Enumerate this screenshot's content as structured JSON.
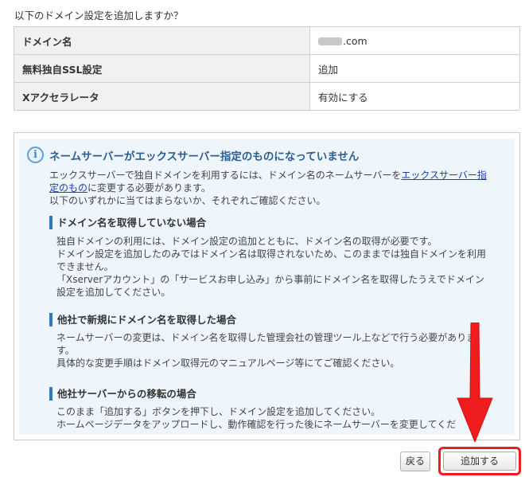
{
  "question": "以下のドメイン設定を追加しますか？",
  "confirm_table": [
    {
      "label": "ドメイン名",
      "value_suffix": ".com"
    },
    {
      "label": "無料独自SSL設定",
      "value": "追加"
    },
    {
      "label": "Xアクセラレータ",
      "value": "有効にする"
    }
  ],
  "notice": {
    "title": "ネームサーバーがエックスサーバー指定のものになっていません",
    "intro_before_link": "エックスサーバーで独自ドメインを利用するには、ドメイン名のネームサーバーを",
    "intro_link_line1": "エックスサーバー指",
    "intro_link_line2": "定のもの",
    "intro_after_link": "に変更する必要があります。",
    "intro_line3": "以下のいずれかに当てはまらないか、それぞれご確認ください。",
    "sections": [
      {
        "heading": "ドメイン名を取得していない場合",
        "lines": [
          "独自ドメインの利用には、ドメイン設定の追加とともに、ドメイン名の取得が必要です。",
          "ドメイン設定を追加したのみではドメイン名は取得されないため、このままでは独自ドメインを利用",
          "できません。",
          "「Xserverアカウント」の「サービスお申し込み」から事前にドメイン名を取得したうえでドメイン",
          "設定を追加してください。"
        ]
      },
      {
        "heading": "他社で新規にドメイン名を取得した場合",
        "lines": [
          "ネームサーバーの変更は、ドメイン名を取得した管理会社の管理ツール上などで行う必要がありま",
          "す。",
          "具体的な変更手順はドメイン取得元のマニュアルページ等にてご確認ください。"
        ]
      },
      {
        "heading": "他社サーバーからの移転の場合",
        "lines": [
          "このまま「追加する」ボタンを押下し、ドメイン設定を追加してください。",
          "ホームページデータをアップロードし、動作確認を行った後にネームサーバーを変更してくだ"
        ]
      }
    ]
  },
  "buttons": {
    "back": "戻る",
    "add": "追加する"
  },
  "colors": {
    "highlight": "#ef1d1d",
    "accent": "#2e7bbf"
  },
  "icons": {
    "info": "info-icon"
  }
}
